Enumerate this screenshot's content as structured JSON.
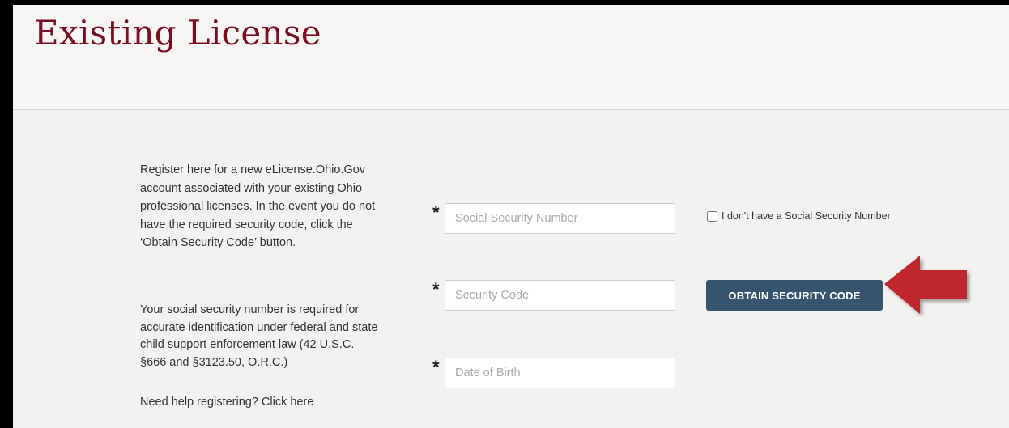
{
  "page": {
    "title": "Existing License"
  },
  "intro": {
    "paragraph1": "Register here for a new eLicense.Ohio.Gov account associated with your existing Ohio professional licenses. In the event you do not have the required security code, click the ‘Obtain Security Code’ button.",
    "paragraph2": "Your social security number is required for accurate identification under federal and state child support enforcement law (42 U.S.C. §666 and §3123.50, O.R.C.)",
    "help_link": "Need help registering? Click here"
  },
  "form": {
    "required_mark": "*",
    "ssn_placeholder": "Social Security Number",
    "security_code_placeholder": "Security Code",
    "dob_placeholder": "Date of Birth",
    "no_ssn_label": "I don't have a Social Security Number",
    "obtain_button": "OBTAIN SECURITY CODE"
  },
  "colors": {
    "title": "#7b0f20",
    "button": "#36546e",
    "arrow": "#c0272d"
  },
  "icons": {
    "annotation": "red-arrow-icon"
  }
}
